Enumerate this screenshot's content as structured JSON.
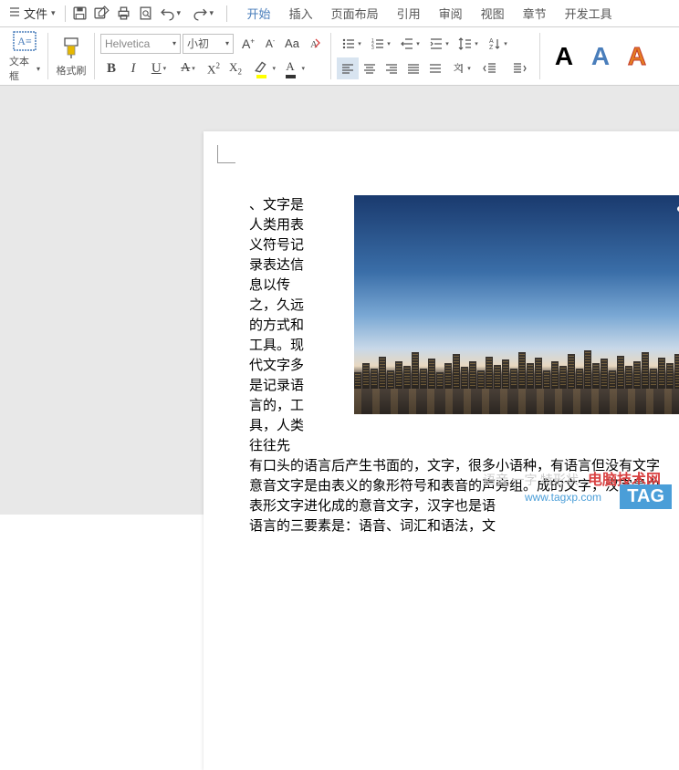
{
  "menu": {
    "file": "文件"
  },
  "tabs": [
    "开始",
    "插入",
    "页面布局",
    "引用",
    "审阅",
    "视图",
    "章节",
    "开发工具"
  ],
  "ribbon": {
    "textbox": "文本框",
    "format_painter": "格式刷",
    "font_name": "Helvetica",
    "font_size": "小初",
    "bold": "B",
    "italic": "I",
    "underline": "U",
    "strike": "A",
    "sup": "X²",
    "sub": "X₂",
    "font_incr": "A⁺",
    "font_decr": "A⁻",
    "highlight": "A",
    "fontcolor": "A"
  },
  "document": {
    "col1": "、文字是人类用表义符号记录表达信息以传之，久远的方式和工具。现代文字多是记录语言的，工具，人类往往先",
    "line1": "有口头的语言后产生书面的，文字，很多小语种，有语言但没有文字",
    "line2": "意音文字是由表义的象形符号和表音的声旁组。成的文字，汉字是由",
    "line3": "表形文字进化成的意音文字，汉字也是语",
    "line4": "语言的三要素是：语音、词汇和语法，文"
  },
  "watermark": {
    "title": "电脑技术网",
    "url": "www.tagxp.com",
    "badge": "TAG",
    "faint": "语音 一字 特形状"
  }
}
